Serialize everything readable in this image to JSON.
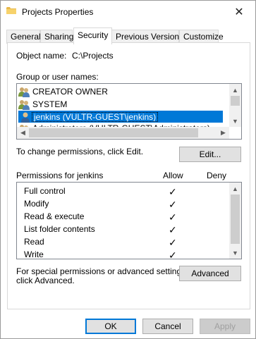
{
  "window": {
    "title": "Projects Properties",
    "close_glyph": "✕",
    "title_icon": "folder-icon"
  },
  "tabs": [
    {
      "label": "General"
    },
    {
      "label": "Sharing"
    },
    {
      "label": "Security"
    },
    {
      "label": "Previous Versions"
    },
    {
      "label": "Customize"
    }
  ],
  "active_tab": "Security",
  "object": {
    "label": "Object name:",
    "value": "C:\\Projects"
  },
  "groups": {
    "label": "Group or user names:",
    "items": [
      {
        "name": "CREATOR OWNER",
        "icon": "group-users-icon"
      },
      {
        "name": "SYSTEM",
        "icon": "group-users-icon"
      },
      {
        "name": "jenkins (VULTR-GUEST\\jenkins)",
        "icon": "single-user-icon",
        "selected": true
      },
      {
        "name": "Administrators (VULTR-GUEST\\Administrators)",
        "icon": "group-users-icon"
      }
    ]
  },
  "change_perm": {
    "text": "To change permissions, click Edit.",
    "edit_button": "Edit..."
  },
  "permissions": {
    "label": "Permissions for jenkins",
    "allow_header": "Allow",
    "deny_header": "Deny",
    "check_glyph": "✓",
    "rows": [
      {
        "name": "Full control",
        "allow": true,
        "deny": false
      },
      {
        "name": "Modify",
        "allow": true,
        "deny": false
      },
      {
        "name": "Read & execute",
        "allow": true,
        "deny": false
      },
      {
        "name": "List folder contents",
        "allow": true,
        "deny": false
      },
      {
        "name": "Read",
        "allow": true,
        "deny": false
      },
      {
        "name": "Write",
        "allow": true,
        "deny": false
      }
    ]
  },
  "advanced": {
    "text_line1": "For special permissions or advanced settings,",
    "text_line2": "click Advanced.",
    "button": "Advanced"
  },
  "footer": {
    "ok": "OK",
    "cancel": "Cancel",
    "apply": "Apply"
  },
  "colors": {
    "selection": "#0078d7",
    "default_button_border": "#0078d7"
  }
}
